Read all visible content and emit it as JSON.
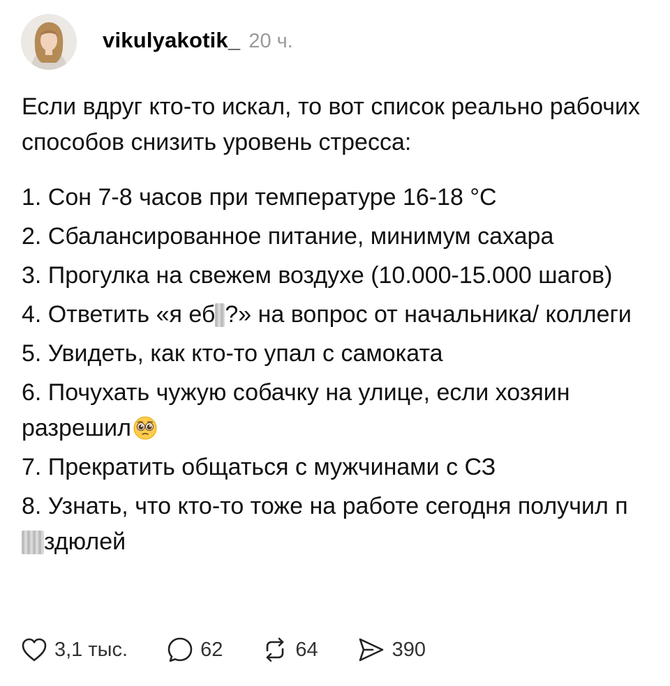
{
  "post": {
    "username": "vikulyakotik_",
    "time": "20 ч.",
    "intro": "Если вдруг кто-то искал, то вот список реально рабочих способов снизить уровень стресса:",
    "items": [
      "1. Сон 7-8 часов при температуре 16-18 °С",
      "2. Сбалансированное питание, минимум сахара",
      "3. Прогулка на свежем воздухе (10.000-15.000 шагов)",
      {
        "before": "4. Ответить «я еб",
        "after": "?» на вопрос от начальника/ коллеги"
      },
      "5. Увидеть, как кто-то упал с самоката",
      {
        "text": "6. Почухать чужую собачку на улице, если хозяин разрешил",
        "emoji": "pleading-face-emoji"
      },
      "7. Прекратить общаться с мужчинами с СЗ",
      {
        "before": "8. Узнать, что кто-то тоже на работе сегодня получил п",
        "after": "здюлей"
      }
    ]
  },
  "actions": {
    "likes": "3,1 тыс.",
    "replies": "62",
    "reposts": "64",
    "shares": "390"
  },
  "icons": {
    "like": "heart-icon",
    "reply": "comment-bubble-icon",
    "repost": "repost-icon",
    "share": "send-icon"
  },
  "colors": {
    "text": "#111111",
    "meta": "#9a9a9a",
    "action_text": "#333333"
  }
}
